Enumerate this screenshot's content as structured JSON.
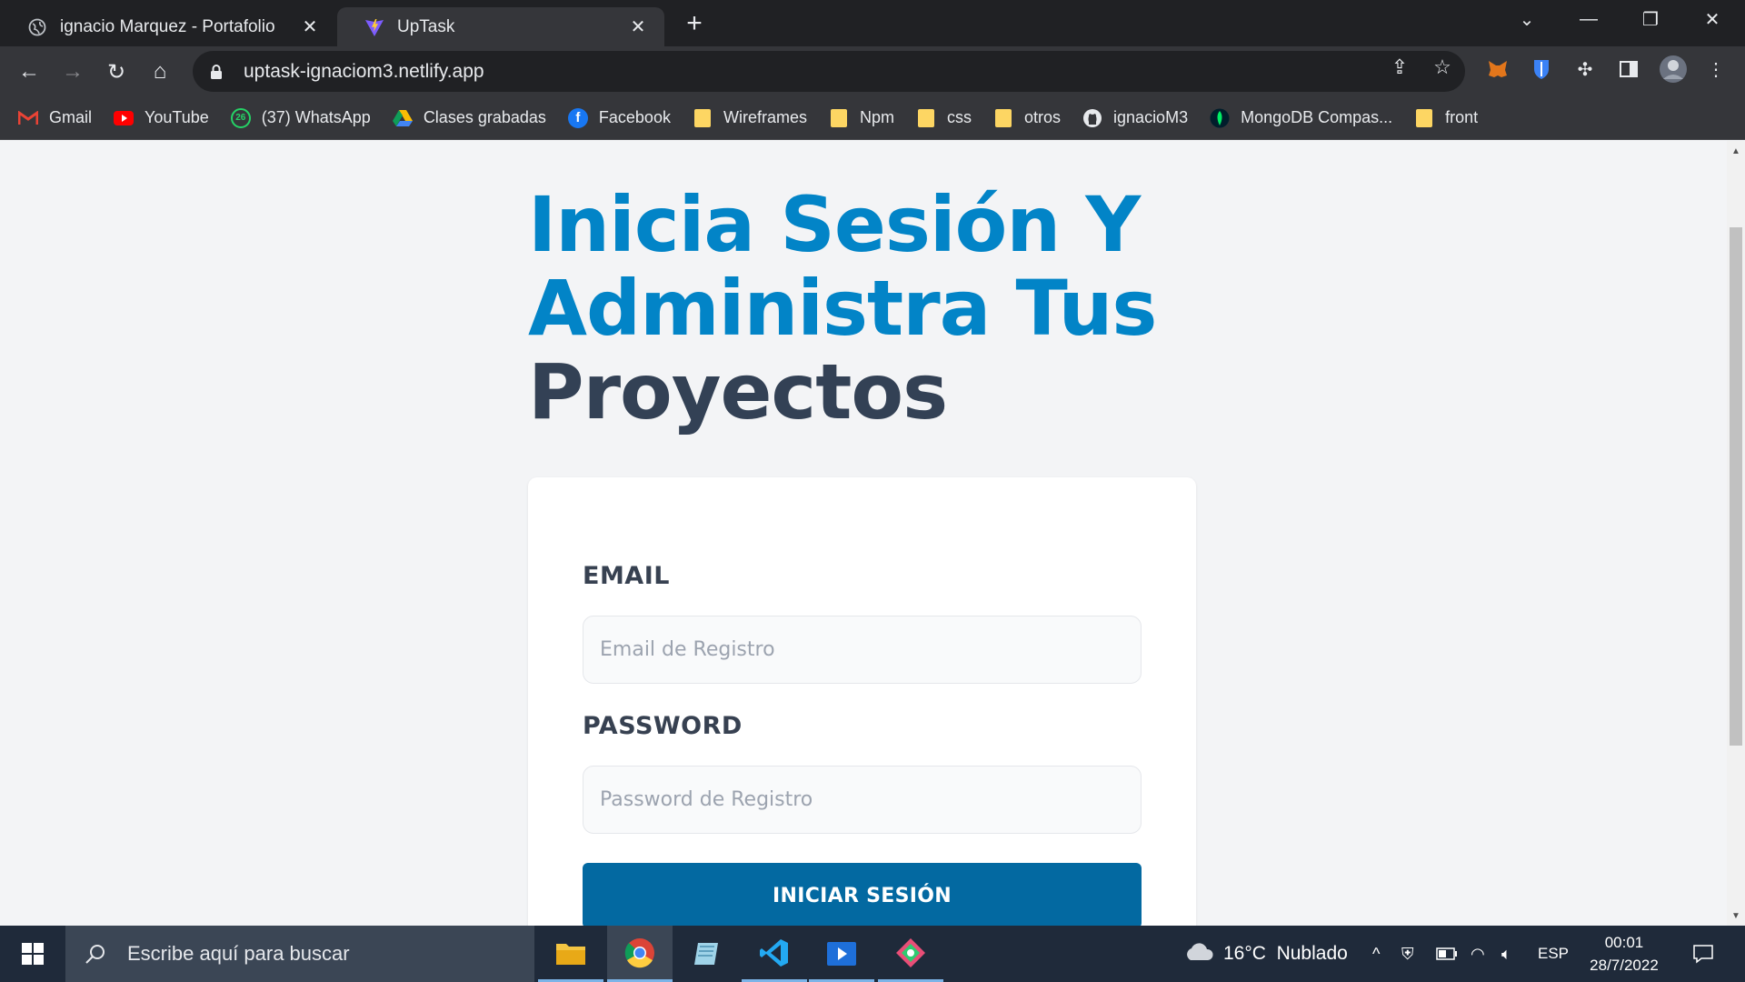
{
  "browser": {
    "tabs": [
      {
        "title": "ignacio Marquez - Portafolio",
        "favicon": "globe-icon",
        "active": false
      },
      {
        "title": "UpTask",
        "favicon": "vite-icon",
        "active": true
      }
    ],
    "url": "uptask-ignaciom3.netlify.app",
    "bookmarks": [
      {
        "label": "Gmail",
        "icon": "gmail-icon"
      },
      {
        "label": "YouTube",
        "icon": "youtube-icon"
      },
      {
        "label": "(37) WhatsApp",
        "icon": "whatsapp-icon",
        "badge": "26"
      },
      {
        "label": "Clases grabadas",
        "icon": "google-drive-icon"
      },
      {
        "label": "Facebook",
        "icon": "facebook-icon"
      },
      {
        "label": "Wireframes",
        "icon": "folder-icon"
      },
      {
        "label": "Npm",
        "icon": "folder-icon"
      },
      {
        "label": "css",
        "icon": "folder-icon"
      },
      {
        "label": "otros",
        "icon": "folder-icon"
      },
      {
        "label": "ignacioM3",
        "icon": "github-icon"
      },
      {
        "label": "MongoDB Compas...",
        "icon": "mongodb-icon"
      },
      {
        "label": "front",
        "icon": "folder-icon"
      }
    ]
  },
  "page": {
    "heading_line1": "Inicia Sesión Y",
    "heading_line2": "Administra Tus",
    "heading_line3": "Proyectos",
    "email_label": "EMAIL",
    "email_placeholder": "Email de Registro",
    "email_value": "",
    "password_label": "PASSWORD",
    "password_placeholder": "Password de Registro",
    "password_value": "",
    "submit_label": "INICIAR SESIÓN"
  },
  "taskbar": {
    "search_placeholder": "Escribe aquí para buscar",
    "weather": "16°C  Nublado",
    "language": "ESP",
    "time": "00:01",
    "date": "28/7/2022"
  },
  "colors": {
    "accent_blue": "#0284c7",
    "heading_dark": "#334155",
    "button": "#0369a1",
    "page_bg": "#f3f4f6"
  }
}
